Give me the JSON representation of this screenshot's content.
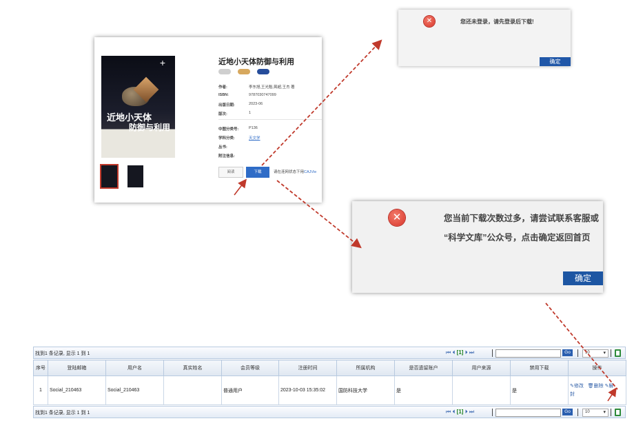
{
  "book": {
    "title": "近地小天体防御与利用",
    "cover_title_line1": "近地小天体",
    "cover_title_line2": "防御与利用",
    "fields": [
      {
        "label": "作者:",
        "value": "李东旭,王光魁,蒋超,王杰 著",
        "link": false
      },
      {
        "label": "ISBN:",
        "value": "9787030747099",
        "link": false
      },
      {
        "label": "出版日期:",
        "value": "2023-06",
        "link": false
      },
      {
        "label": "版次:",
        "value": "1",
        "link": false
      },
      {
        "label": "中图分类号:",
        "value": "P136",
        "link": false
      },
      {
        "label": "学科分类:",
        "value": "天文学",
        "link": true
      },
      {
        "label": "丛书:",
        "value": "",
        "link": false
      },
      {
        "label": "附注信息:",
        "value": "",
        "link": false
      }
    ],
    "read_button": "阅读",
    "download_button": "下载",
    "note_prefix": "请在连网状态下用",
    "note_link": "CAJVie"
  },
  "dialog_login": {
    "message": "您还未登录，请先登录后下载!",
    "ok": "确定"
  },
  "dialog_limit": {
    "line1": "您当前下载次数过多，请尝试联系客服或",
    "line2": "“科学文库”公众号，点击确定返回首页",
    "ok": "确定"
  },
  "grid": {
    "top_info": "找到1 条记录, 显示 1 到 1",
    "bottom_info": "找到1 条记录, 显示 1 到 1",
    "current_page": "[1]",
    "go": "Go",
    "page_size": "10",
    "columns": [
      "序号",
      "登陆邮箱",
      "用户名",
      "真实姓名",
      "会员等级",
      "注册时间",
      "所属机构",
      "是否遗留账户",
      "用户来源",
      "禁用下载",
      "操作"
    ],
    "rows": [
      {
        "index": "1",
        "email": "Social_210463",
        "username": "Social_210463",
        "realname": "",
        "level": "普通用户",
        "registered": "2023-10-03 15:35:02",
        "org": "国防科技大学",
        "legacy": "是",
        "source": "",
        "disabled": "是",
        "op_edit": "修改",
        "op_edit_tail": "封",
        "op_delete": "删除",
        "op_unlock": "解"
      }
    ]
  },
  "colors": {
    "accent": "#2f6cc7",
    "annotation": "#c0392b",
    "grid_border": "#b7c9df"
  }
}
